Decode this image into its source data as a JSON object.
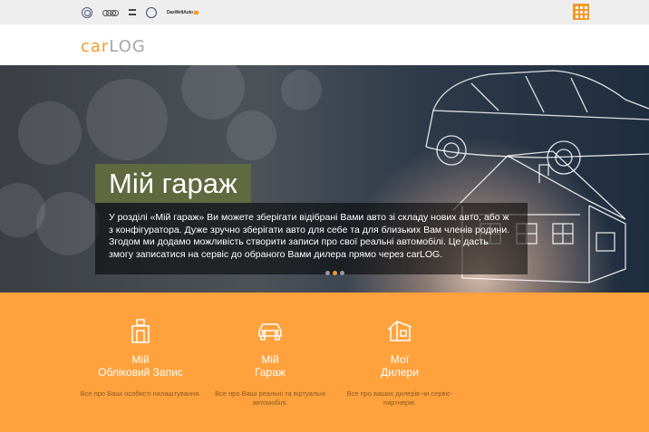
{
  "topbar": {
    "brands": [
      {
        "icon": "volkswagen-logo-icon"
      },
      {
        "icon": "audi-logo-icon"
      },
      {
        "icon": "skoda-logo-icon"
      },
      {
        "icon": "vw-commercial-logo-icon"
      },
      {
        "icon": "das-weltauto-logo-icon",
        "text": "DasWeltAuto"
      }
    ],
    "menu_icon": "grid-menu-icon",
    "accent": "#f39a2b"
  },
  "header": {
    "logo_part1": "car",
    "logo_part2": "LOG"
  },
  "hero": {
    "title": "Мій гараж",
    "text": "У розділі «Мій гараж» Ви можете зберігати відібрані Вами авто зі складу нових авто, або ж з конфігуратора. Дуже зручно зберігати авто для себе та для близьких Вам членів родини. Згодом ми додамо можливість створити записи про свої реальні автомобілі. Це дасть змогу записатися на сервіс до обраного Вами дилера прямо через carLOG.",
    "slides_total": 3,
    "active_slide": 2
  },
  "features": {
    "background": "#ffa13c",
    "items": [
      {
        "icon": "person-id-icon",
        "title_line1": "Мій",
        "title_line2": "Обліковий Запис",
        "desc": "Все про Ваші особисті налаштування."
      },
      {
        "icon": "car-icon",
        "title_line1": "Мій",
        "title_line2": "Гараж",
        "desc": "Все про Ваші реальні та віртуальні автомобілі."
      },
      {
        "icon": "house-icon",
        "title_line1": "Мої",
        "title_line2": "Дилери",
        "desc": "Все про ваших дилерів чи сервіс-партнерів."
      }
    ]
  }
}
